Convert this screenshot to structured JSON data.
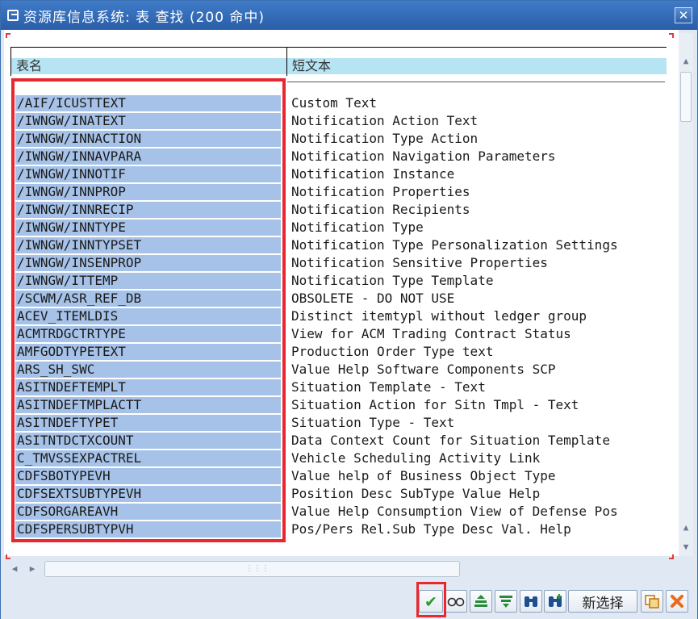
{
  "window": {
    "title": "资源库信息系统: 表 查找 (200 命中)",
    "close_symbol": "✕"
  },
  "table": {
    "headers": [
      "表名",
      "短文本"
    ],
    "rows": [
      [
        "/AIF/ICUSTTEXT",
        "Custom Text"
      ],
      [
        "/IWNGW/INATEXT",
        "Notification Action Text"
      ],
      [
        "/IWNGW/INNACTION",
        "Notification Type Action"
      ],
      [
        "/IWNGW/INNAVPARA",
        "Notification Navigation Parameters"
      ],
      [
        "/IWNGW/INNOTIF",
        "Notification Instance"
      ],
      [
        "/IWNGW/INNPROP",
        "Notification Properties"
      ],
      [
        "/IWNGW/INNRECIP",
        "Notification Recipients"
      ],
      [
        "/IWNGW/INNTYPE",
        "Notification Type"
      ],
      [
        "/IWNGW/INNTYPSET",
        "Notification Type Personalization Settings"
      ],
      [
        "/IWNGW/INSENPROP",
        "Notification Sensitive Properties"
      ],
      [
        "/IWNGW/ITTEMP",
        "Notification Type Template"
      ],
      [
        "/SCWM/ASR_REF_DB",
        "OBSOLETE - DO NOT USE"
      ],
      [
        "ACEV_ITEMLDIS",
        "Distinct itemtypl without ledger group"
      ],
      [
        "ACMTRDGCTRTYPE",
        "View for ACM Trading Contract Status"
      ],
      [
        "AMFGODTYPETEXT",
        "Production Order Type text"
      ],
      [
        "ARS_SH_SWC",
        "Value Help Software Components SCP"
      ],
      [
        "ASITNDEFTEMPLT",
        "Situation Template - Text"
      ],
      [
        "ASITNDEFTMPLACTT",
        "Situation Action for Sitn Tmpl - Text"
      ],
      [
        "ASITNDEFTYPET",
        "Situation Type - Text"
      ],
      [
        "ASITNTDCTXCOUNT",
        "Data Context Count for Situation Template"
      ],
      [
        "C_TMVSSEXPACTREL",
        "Vehicle Scheduling Activity Link"
      ],
      [
        "CDFSBOTYPEVH",
        "Value help of Business Object Type"
      ],
      [
        "CDFSEXTSUBTYPEVH",
        "Position Desc SubType Value Help"
      ],
      [
        "CDFSORGAREAVH",
        "Value Help Consumption View of Defense Pos"
      ],
      [
        "CDFSPERSUBTYPVH",
        "Pos/Pers Rel.Sub Type Desc Val. Help"
      ]
    ]
  },
  "footer": {
    "new_selection_label": "新选择"
  },
  "icons": [
    "window-icon",
    "close-icon",
    "scroll-up-icon",
    "scroll-down-icon",
    "scroll-left-icon",
    "scroll-right-icon",
    "checkmark-icon",
    "glasses-icon",
    "sort-ascending-icon",
    "filter-icon",
    "binoculars-icon",
    "binoculars-plus-icon",
    "copy-icon",
    "cancel-icon"
  ],
  "colors": {
    "title_bar": "#2f67b3",
    "header_fill": "#b6e4f2",
    "selected_column": "#a6c2e8",
    "highlight": "#e8272e",
    "confirm_check": "#2c9a2c",
    "cancel": "#e86a1a"
  }
}
